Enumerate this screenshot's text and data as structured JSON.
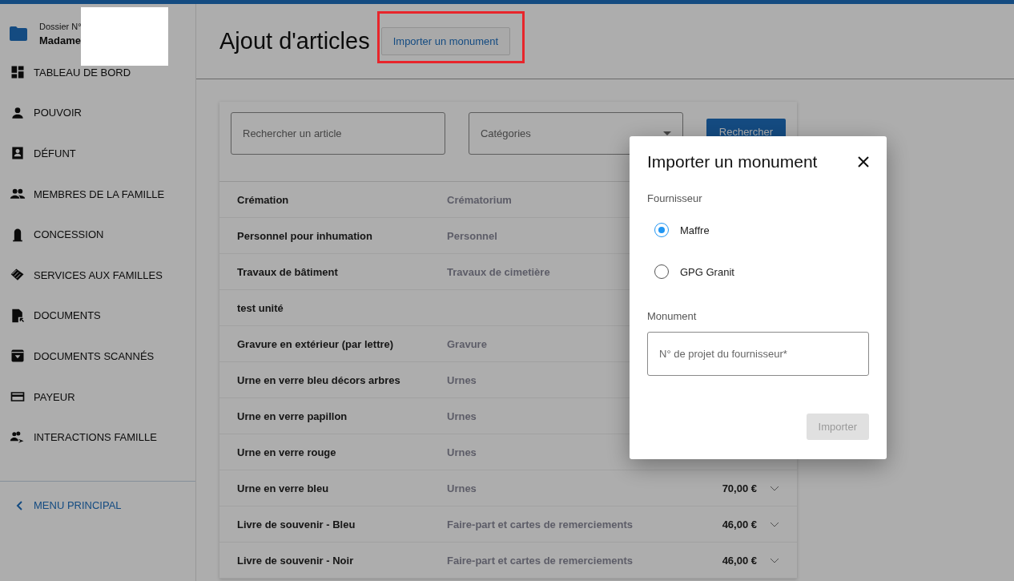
{
  "sidebar": {
    "folder": {
      "label": "Dossier N°",
      "name": "Madame"
    },
    "items": [
      {
        "label": "TABLEAU DE BORD"
      },
      {
        "label": "POUVOIR"
      },
      {
        "label": "DÉFUNT"
      },
      {
        "label": "MEMBRES DE LA FAMILLE"
      },
      {
        "label": "CONCESSION"
      },
      {
        "label": "SERVICES AUX FAMILLES"
      },
      {
        "label": "DOCUMENTS"
      },
      {
        "label": "DOCUMENTS SCANNÉS"
      },
      {
        "label": "PAYEUR"
      },
      {
        "label": "INTERACTIONS FAMILLE"
      }
    ],
    "back_link": "MENU PRINCIPAL"
  },
  "header": {
    "title": "Ajout d'articles",
    "import_button": "Importer un monument"
  },
  "filters": {
    "search_placeholder": "Rechercher un article",
    "category_placeholder": "Catégories",
    "search_button": "Rechercher"
  },
  "articles": [
    {
      "name": "Crémation",
      "category": "Crématorium"
    },
    {
      "name": "Personnel pour inhumation",
      "category": "Personnel"
    },
    {
      "name": "Travaux de bâtiment",
      "category": "Travaux de cimetière"
    },
    {
      "name": "test unité"
    },
    {
      "name": "Gravure en extérieur (par lettre)",
      "category": "Gravure"
    },
    {
      "name": "Urne en verre bleu décors arbres",
      "category": "Urnes"
    },
    {
      "name": "Urne en verre papillon",
      "category": "Urnes"
    },
    {
      "name": "Urne en verre rouge",
      "category": "Urnes"
    },
    {
      "name": "Urne en verre bleu",
      "category": "Urnes",
      "price": "70,00 €"
    },
    {
      "name": "Livre de souvenir - Bleu",
      "category": "Faire-part et cartes de remerciements",
      "price": "46,00 €"
    },
    {
      "name": "Livre de souvenir - Noir",
      "category": "Faire-part et cartes de remerciements",
      "price": "46,00 €"
    }
  ],
  "dialog": {
    "title": "Importer un monument",
    "supplier_label": "Fournisseur",
    "suppliers": [
      {
        "label": "Maffre",
        "selected": true
      },
      {
        "label": "GPG Granit",
        "selected": false
      }
    ],
    "monument_label": "Monument",
    "project_placeholder": "N° de projet du fournisseur*",
    "import_button": "Importer",
    "import_disabled": true
  }
}
